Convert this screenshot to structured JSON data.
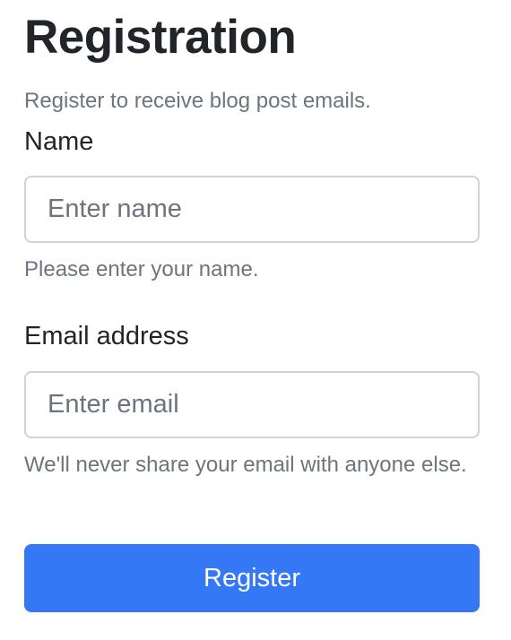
{
  "form": {
    "title": "Registration",
    "subtitle": "Register to receive blog post emails.",
    "name_label": "Name",
    "name_placeholder": "Enter name",
    "name_value": "",
    "name_help": "Please enter your name.",
    "email_label": "Email address",
    "email_placeholder": "Enter email",
    "email_value": "",
    "email_help": "We'll never share your email with anyone else.",
    "submit_label": "Register"
  },
  "colors": {
    "primary": "#3478f6",
    "muted_text": "#6c757d",
    "body_text": "#212529",
    "input_border": "#ced4da"
  }
}
